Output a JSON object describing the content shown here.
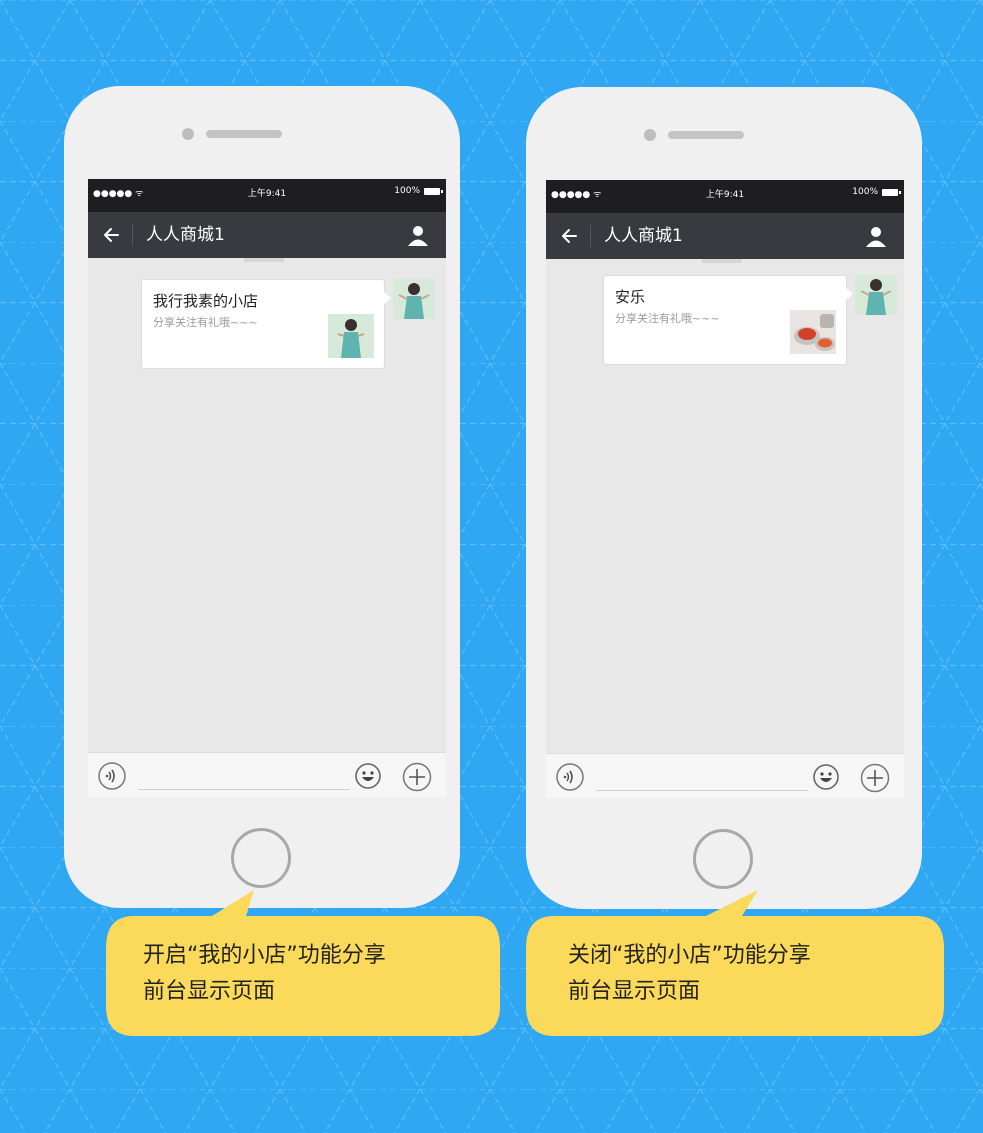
{
  "colors": {
    "background": "#2fa7f3",
    "phone_body": "#f0f0f0",
    "navbar": "#393a3f",
    "statusbar": "#1d1d22",
    "callout": "#fbd95a"
  },
  "phones": [
    {
      "status": {
        "signal": "●●●●● ᯤ",
        "time": "上午9:41",
        "battery": "100%"
      },
      "nav": {
        "back_icon": "arrow-left-icon",
        "title": "人人商城1",
        "profile_icon": "person-icon"
      },
      "message": {
        "title": "我行我素的小店",
        "description": "分享关注有礼哦~~~"
      },
      "input": {
        "voice_icon": "voice-icon",
        "emoji_icon": "emoji-icon",
        "more_icon": "plus-icon"
      },
      "caption": [
        "开启“我的小店”功能分享",
        "前台显示页面"
      ]
    },
    {
      "status": {
        "signal": "●●●●● ᯤ",
        "time": "上午9:41",
        "battery": "100%"
      },
      "nav": {
        "back_icon": "arrow-left-icon",
        "title": "人人商城1",
        "profile_icon": "person-icon"
      },
      "message": {
        "title": "安乐",
        "description": "分享关注有礼哦~~~"
      },
      "input": {
        "voice_icon": "voice-icon",
        "emoji_icon": "emoji-icon",
        "more_icon": "plus-icon"
      },
      "caption": [
        "关闭“我的小店”功能分享",
        "前台显示页面"
      ]
    }
  ]
}
